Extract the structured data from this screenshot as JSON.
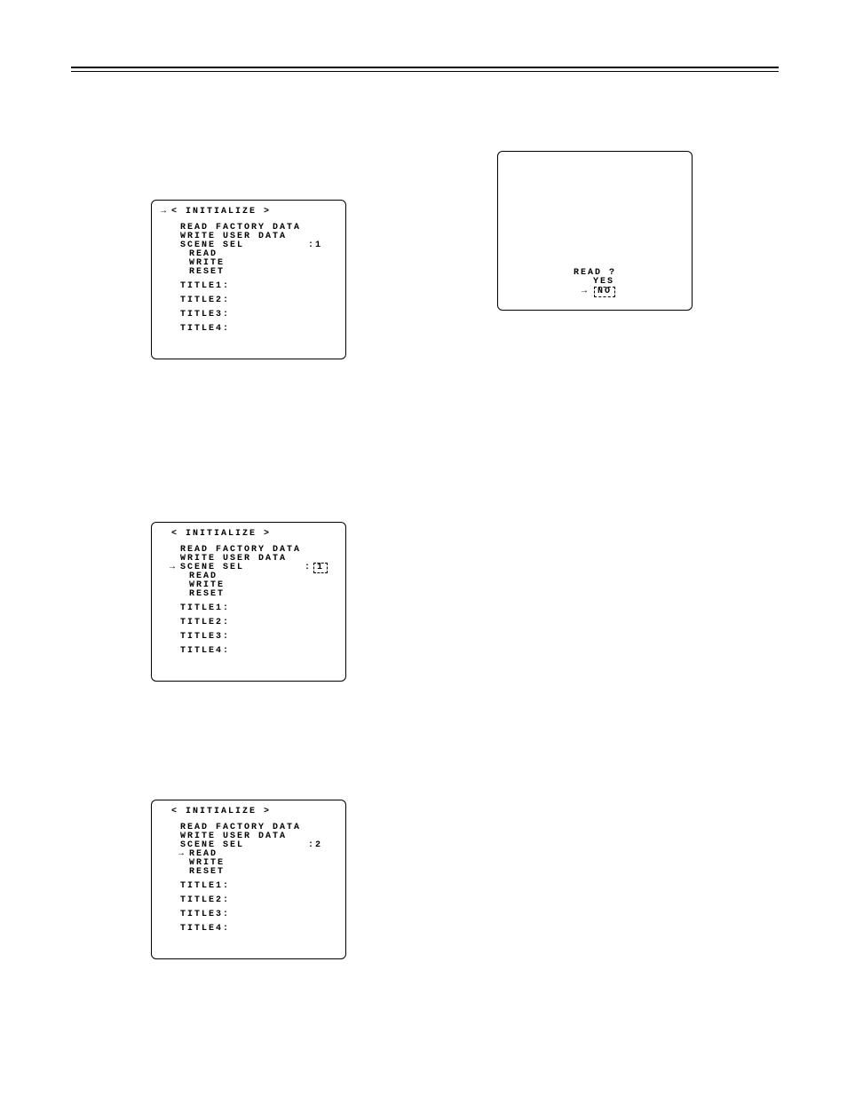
{
  "rule": {},
  "panel1": {
    "title": "< INITIALIZE >",
    "items": {
      "read_factory": "READ FACTORY DATA",
      "write_user": "WRITE USER DATA",
      "scene_sel_label": "SCENE SEL",
      "scene_sel_value": ":1",
      "read": "READ",
      "write": "WRITE",
      "reset": "RESET",
      "title1": "TITLE1:",
      "title2": "TITLE2:",
      "title3": "TITLE3:",
      "title4": "TITLE4:"
    },
    "cursor_glyph": "→"
  },
  "panel2": {
    "title": "< INITIALIZE >",
    "items": {
      "read_factory": "READ FACTORY DATA",
      "write_user": "WRITE USER DATA",
      "scene_sel_label": "SCENE SEL",
      "scene_sel_value": "1",
      "read": "READ",
      "write": "WRITE",
      "reset": "RESET",
      "title1": "TITLE1:",
      "title2": "TITLE2:",
      "title3": "TITLE3:",
      "title4": "TITLE4:"
    },
    "cursor_glyph": "→"
  },
  "panel3": {
    "title": "< INITIALIZE >",
    "items": {
      "read_factory": "READ FACTORY DATA",
      "write_user": "WRITE USER DATA",
      "scene_sel_label": "SCENE SEL",
      "scene_sel_value": ":2",
      "read": "READ",
      "write": "WRITE",
      "reset": "RESET",
      "title1": "TITLE1:",
      "title2": "TITLE2:",
      "title3": "TITLE3:",
      "title4": "TITLE4:"
    },
    "cursor_glyph": "→"
  },
  "confirm": {
    "prompt": "READ ?",
    "yes": "YES",
    "no": "NO",
    "cursor_glyph": "→"
  }
}
